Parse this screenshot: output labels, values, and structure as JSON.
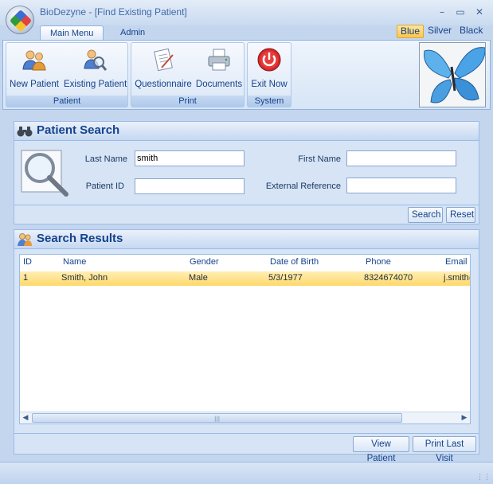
{
  "window": {
    "title": "BioDezyne - [Find Existing Patient]"
  },
  "tabs": [
    {
      "label": "Main Menu"
    },
    {
      "label": "Admin"
    }
  ],
  "themes": [
    {
      "label": "Blue"
    },
    {
      "label": "Silver"
    },
    {
      "label": "Black"
    }
  ],
  "ribbon": {
    "groups": [
      {
        "label": "Patient",
        "buttons": [
          {
            "label": "New Patient",
            "icon": "users-icon"
          },
          {
            "label": "Existing Patient",
            "icon": "search-user-icon"
          }
        ]
      },
      {
        "label": "Print",
        "buttons": [
          {
            "label": "Questionnaire",
            "icon": "questionnaire-icon"
          },
          {
            "label": "Documents",
            "icon": "printer-icon"
          }
        ]
      },
      {
        "label": "System",
        "buttons": [
          {
            "label": "Exit Now",
            "icon": "power-icon"
          }
        ]
      }
    ]
  },
  "search": {
    "title": "Patient Search",
    "last_name_label": "Last Name",
    "last_name_value": "smith",
    "first_name_label": "First Name",
    "first_name_value": "",
    "patient_id_label": "Patient ID",
    "patient_id_value": "",
    "external_ref_label": "External Reference",
    "external_ref_value": "",
    "search_button": "Search",
    "reset_button": "Reset"
  },
  "results": {
    "title": "Search Results",
    "columns": [
      "ID",
      "Name",
      "Gender",
      "Date of Birth",
      "Phone",
      "Email"
    ],
    "rows": [
      [
        "1",
        "Smith, John",
        "Male",
        "5/3/1977",
        "8324674070",
        "j.smith@"
      ]
    ],
    "view_button": "View Patient",
    "print_button": "Print Last Visit"
  },
  "colors": {
    "accent": "#15428b",
    "selection": "#ffd86b",
    "panel": "#d6e4f5"
  }
}
